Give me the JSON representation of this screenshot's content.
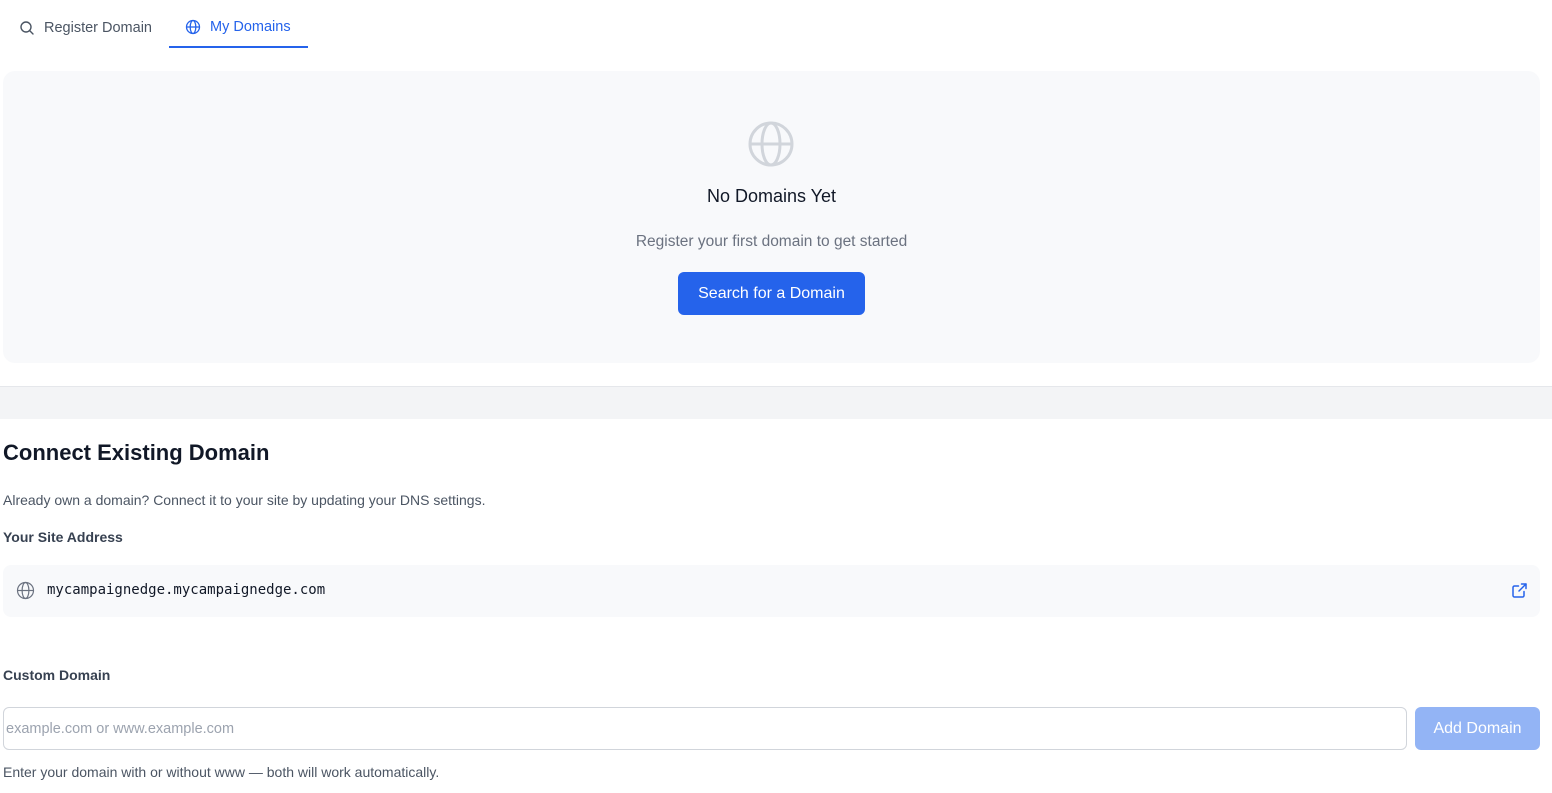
{
  "tabs": [
    {
      "label": "Register Domain",
      "icon": "search-icon",
      "active": false
    },
    {
      "label": "My Domains",
      "icon": "globe-icon",
      "active": true
    }
  ],
  "empty_state": {
    "icon": "globe-icon",
    "title": "No Domains Yet",
    "subtitle": "Register your first domain to get started",
    "button_label": "Search for a Domain"
  },
  "connect": {
    "title": "Connect Existing Domain",
    "description": "Already own a domain? Connect it to your site by updating your DNS settings.",
    "site_address_label": "Your Site Address",
    "site_address": "mycampaignedge.mycampaignedge.com",
    "custom_domain_label": "Custom Domain",
    "custom_domain_placeholder": "example.com or www.example.com",
    "custom_domain_value": "",
    "add_button_label": "Add Domain",
    "hint": "Enter your domain with or without www — both will work automatically."
  },
  "colors": {
    "accent": "#2563eb",
    "accent_disabled": "#93b4f5",
    "card_background": "#f8f9fb",
    "muted_text": "#6b7280"
  }
}
